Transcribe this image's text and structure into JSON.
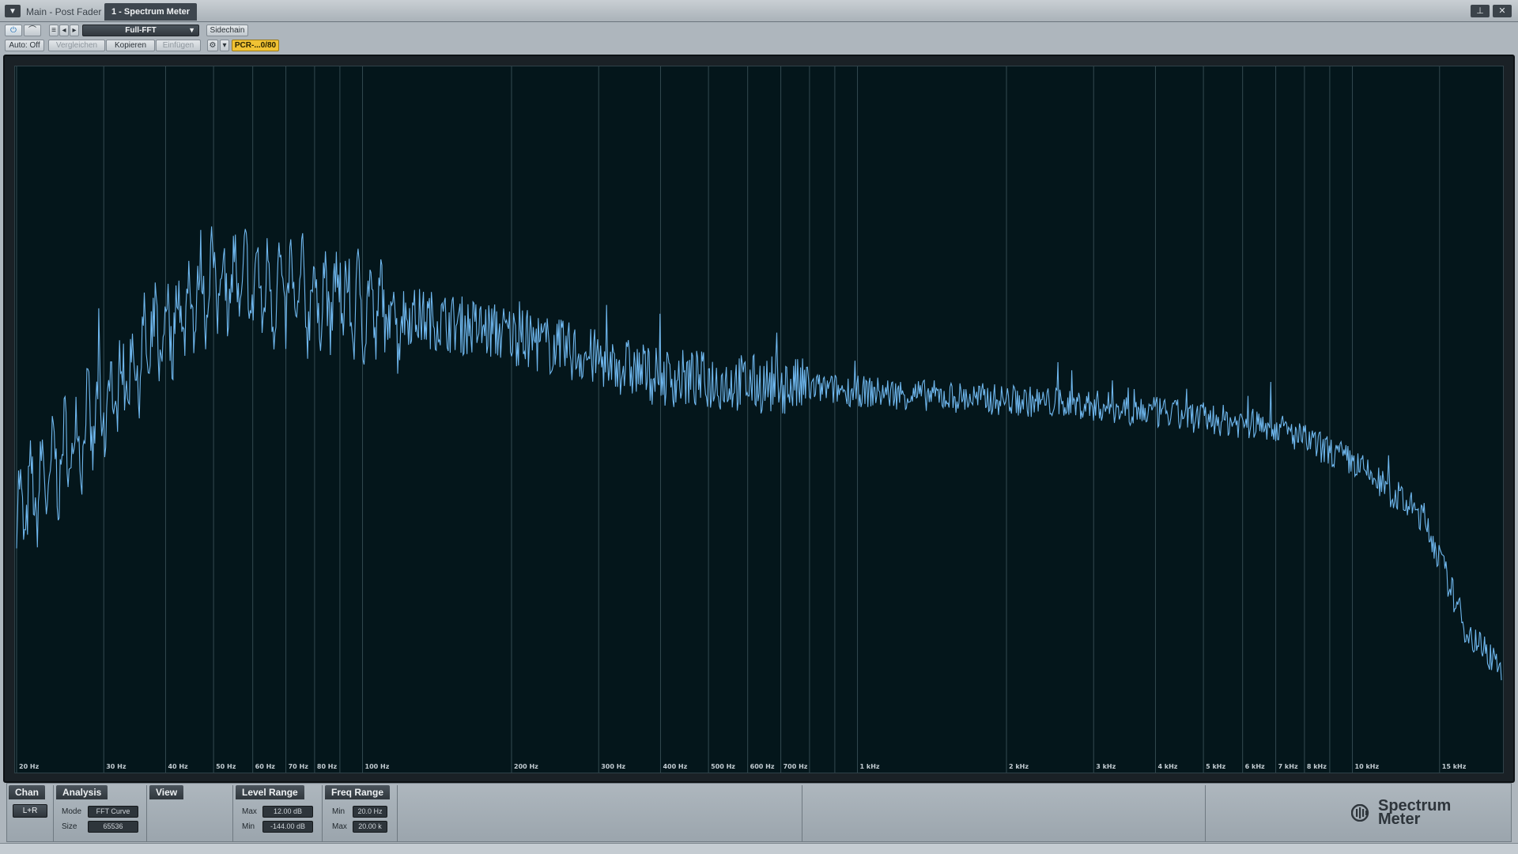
{
  "window": {
    "menu_icon": "menu-triangle-icon",
    "inactive_tab": "Main - Post Fader",
    "active_tab": "1 - Spectrum Meter",
    "pin_icon": "pin-icon",
    "close_icon": "close-icon"
  },
  "toolbar": {
    "preset_name": "Full-FFT",
    "sidechain_label": "Sidechain",
    "auto_label": "Auto: Off",
    "compare_label": "Vergleichen",
    "copy_label": "Kopieren",
    "paste_label": "Einfügen",
    "badge_label": "PCR-...0/80"
  },
  "analyzer": {
    "freq_min_hz": 20,
    "freq_max_hz": 20000,
    "axis_scale": "log",
    "curve_color": "#6fb7ee",
    "grid_color": "#334950",
    "freq_labels": [
      {
        "hz": 20,
        "label": "20 Hz"
      },
      {
        "hz": 30,
        "label": "30 Hz"
      },
      {
        "hz": 40,
        "label": "40 Hz"
      },
      {
        "hz": 50,
        "label": "50 Hz"
      },
      {
        "hz": 60,
        "label": "60 Hz"
      },
      {
        "hz": 70,
        "label": "70 Hz"
      },
      {
        "hz": 80,
        "label": "80 Hz"
      },
      {
        "hz": 100,
        "label": "100 Hz"
      },
      {
        "hz": 200,
        "label": "200 Hz"
      },
      {
        "hz": 300,
        "label": "300 Hz"
      },
      {
        "hz": 400,
        "label": "400 Hz"
      },
      {
        "hz": 500,
        "label": "500 Hz"
      },
      {
        "hz": 600,
        "label": "600 Hz"
      },
      {
        "hz": 700,
        "label": "700 Hz"
      },
      {
        "hz": 1000,
        "label": "1 kHz"
      },
      {
        "hz": 2000,
        "label": "2 kHz"
      },
      {
        "hz": 3000,
        "label": "3 kHz"
      },
      {
        "hz": 4000,
        "label": "4 kHz"
      },
      {
        "hz": 5000,
        "label": "5 kHz"
      },
      {
        "hz": 6000,
        "label": "6 kHz"
      },
      {
        "hz": 7000,
        "label": "7 kHz"
      },
      {
        "hz": 8000,
        "label": "8 kHz"
      },
      {
        "hz": 10000,
        "label": "10 kHz"
      },
      {
        "hz": 15000,
        "label": "15 kHz"
      }
    ],
    "extra_gridlines_hz": [
      90,
      800,
      900,
      9000
    ],
    "spectrum_envelope": [
      {
        "hz": 20,
        "level": 0.36
      },
      {
        "hz": 25,
        "level": 0.45
      },
      {
        "hz": 30,
        "level": 0.52
      },
      {
        "hz": 40,
        "level": 0.63
      },
      {
        "hz": 50,
        "level": 0.7
      },
      {
        "hz": 70,
        "level": 0.68
      },
      {
        "hz": 100,
        "level": 0.66
      },
      {
        "hz": 200,
        "level": 0.62
      },
      {
        "hz": 400,
        "level": 0.56
      },
      {
        "hz": 1000,
        "level": 0.54
      },
      {
        "hz": 3000,
        "level": 0.52
      },
      {
        "hz": 7000,
        "level": 0.49
      },
      {
        "hz": 10000,
        "level": 0.44
      },
      {
        "hz": 14000,
        "level": 0.36
      },
      {
        "hz": 17000,
        "level": 0.2
      },
      {
        "hz": 20000,
        "level": 0.15
      }
    ]
  },
  "panel": {
    "chan_tab": "Chan",
    "chan_button": "L+R",
    "analysis_tab": "Analysis",
    "mode_label": "Mode",
    "mode_value": "FFT Curve",
    "size_label": "Size",
    "size_value": "65536",
    "view_tab": "View",
    "level_tab": "Level Range",
    "level_max_label": "Max",
    "level_max_value": "12.00 dB",
    "level_min_label": "Min",
    "level_min_value": "-144.00 dB",
    "freq_tab": "Freq Range",
    "freq_min_label": "Min",
    "freq_min_value": "20.0 Hz",
    "freq_max_label": "Max",
    "freq_max_value": "20.00 k",
    "logo_line1": "Spectrum",
    "logo_line2": "Meter"
  }
}
